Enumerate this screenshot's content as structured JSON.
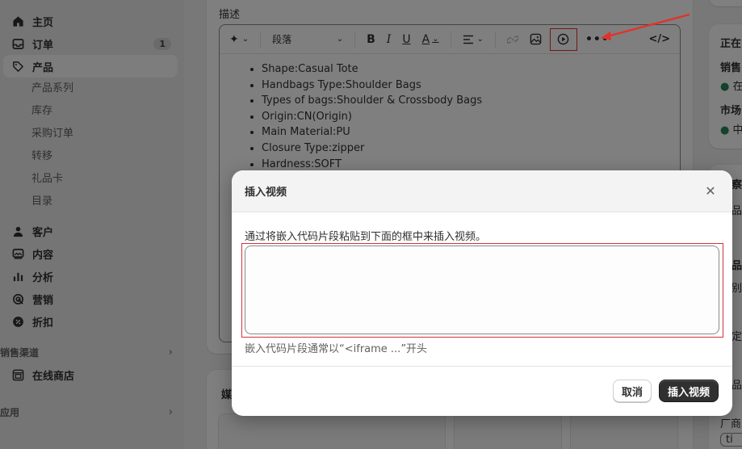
{
  "sidebar": {
    "nav_top": [
      {
        "label": "主页",
        "icon": "home-icon"
      },
      {
        "label": "订单",
        "icon": "inbox-icon",
        "badge": "1"
      },
      {
        "label": "产品",
        "icon": "tag-icon",
        "active": true
      }
    ],
    "product_sub": [
      "产品系列",
      "库存",
      "采购订单",
      "转移",
      "礼品卡",
      "目录"
    ],
    "nav_bottom": [
      {
        "label": "客户",
        "icon": "person-icon"
      },
      {
        "label": "内容",
        "icon": "image-icon"
      },
      {
        "label": "分析",
        "icon": "bar-chart-icon"
      },
      {
        "label": "营销",
        "icon": "target-icon"
      },
      {
        "label": "折扣",
        "icon": "discount-icon"
      }
    ],
    "sales_channels": "销售渠道",
    "online_store": "在线商店",
    "apps": "应用"
  },
  "editor": {
    "label": "描述",
    "paragraph_select": "段落",
    "bullets": [
      "Shape:Casual Tote",
      "Handbags Type:Shoulder Bags",
      "Types of bags:Shoulder & Crossbody Bags",
      "Origin:CN(Origin)",
      "Main Material:PU",
      "Closure Type:zipper",
      "Hardness:SOFT"
    ]
  },
  "media": {
    "title": "媒"
  },
  "right_panel": {
    "status_title": "正在",
    "sales": "销售",
    "status1": "在",
    "market": "市场",
    "status2": "中",
    "insight": "察",
    "r1": "品",
    "r2": "品",
    "r3": "别",
    "r4": "定",
    "r5": "品",
    "vendor": "厂商",
    "vendor_val": "ti"
  },
  "dialog": {
    "title": "插入视频",
    "instructions": "通过将嵌入代码片段粘贴到下面的框中来插入视频。",
    "textarea_value": "",
    "help": "嵌入代码片段通常以“<iframe ...”开头",
    "cancel": "取消",
    "insert": "插入视频"
  },
  "colors": {
    "annotation_red": "#e0332b",
    "primary_button": "#303030"
  }
}
